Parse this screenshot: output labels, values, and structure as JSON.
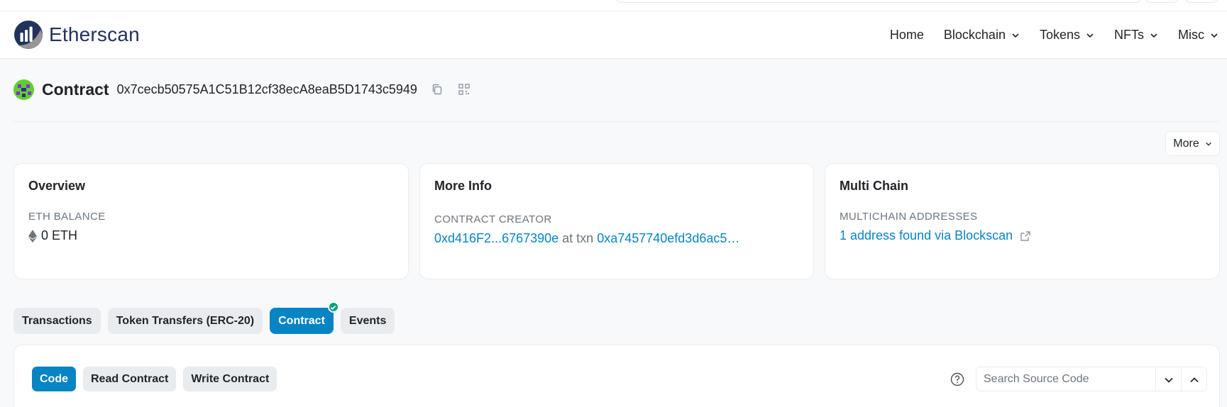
{
  "brand": {
    "name": "Etherscan"
  },
  "nav": {
    "items": [
      {
        "label": "Home"
      },
      {
        "label": "Blockchain"
      },
      {
        "label": "Tokens"
      },
      {
        "label": "NFTs"
      },
      {
        "label": "Misc"
      }
    ]
  },
  "header": {
    "title": "Contract",
    "address": "0x7cecb50575A1C51B12cf38ecA8eaB5D1743c5949",
    "icons": [
      "copy-icon",
      "qr-code-icon"
    ]
  },
  "more_button": {
    "label": "More"
  },
  "cards": {
    "overview": {
      "title": "Overview",
      "label": "ETH BALANCE",
      "value": "0 ETH"
    },
    "more_info": {
      "title": "More Info",
      "label": "CONTRACT CREATOR",
      "creator": "0xd416F2...6767390e",
      "at_txn": "at txn",
      "txn": "0xa7457740efd3d6ac5…"
    },
    "multi_chain": {
      "title": "Multi Chain",
      "label": "MULTICHAIN ADDRESSES",
      "link": "1 address found via Blockscan"
    }
  },
  "tabs": [
    {
      "label": "Transactions"
    },
    {
      "label": "Token Transfers (ERC-20)"
    },
    {
      "label": "Contract"
    },
    {
      "label": "Events"
    }
  ],
  "subtabs": [
    {
      "label": "Code"
    },
    {
      "label": "Read Contract"
    },
    {
      "label": "Write Contract"
    }
  ],
  "search": {
    "placeholder": "Search Source Code"
  },
  "colors": {
    "accent": "#0784c3",
    "brand": "#21325b",
    "success": "#00a186"
  }
}
